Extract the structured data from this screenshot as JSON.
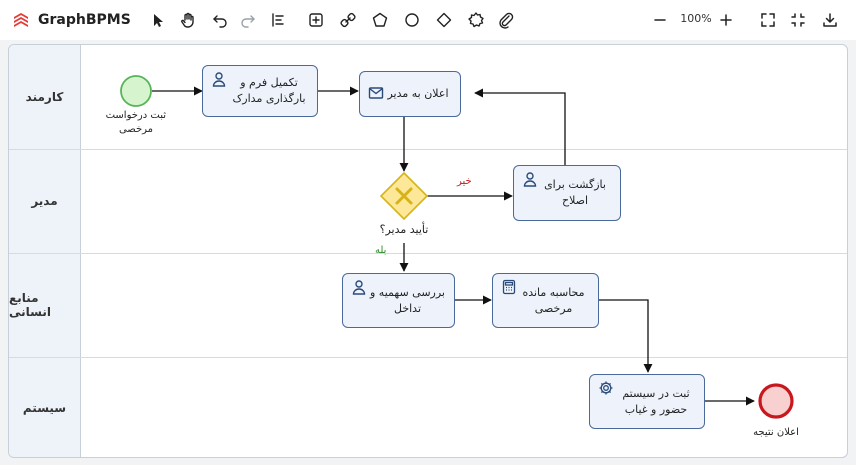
{
  "app": {
    "title": "GraphBPMS",
    "zoom": "100%"
  },
  "toolbar_tools": [
    "select-tool",
    "hand-tool",
    "undo",
    "redo",
    "align-tool",
    "insert-task-tool",
    "connector-tool",
    "pentagon-shape-tool",
    "circle-shape-tool",
    "diamond-shape-tool",
    "settings-shape-tool",
    "attachment-tool"
  ],
  "colors": {
    "brand": "#e53935",
    "task_fill": "#eef3fb",
    "task_stroke": "#4a6a9c",
    "start_fill": "#d6f5cf",
    "start_stroke": "#58b456",
    "end_fill": "#f8d0d0",
    "end_stroke": "#c8181e",
    "gateway_fill": "#fde89a",
    "gateway_stroke": "#d7b318",
    "no_label": "#c8181e",
    "yes_label": "#2e8b2e"
  },
  "lanes": [
    {
      "name": "کارمند"
    },
    {
      "name": "مدیر"
    },
    {
      "name": "منابع انسانی"
    },
    {
      "name": "سیستم"
    }
  ],
  "diagram": {
    "start_event": {
      "label": "ثبت درخواست مرخصی",
      "line1": "ثبت درخواست",
      "line2": "مرخصی"
    },
    "end_event": {
      "label": "اعلان نتیجه"
    },
    "gateway": {
      "label": "تأیید مدیر؟"
    },
    "tasks": {
      "fill_form": {
        "line1": "تکمیل فرم و",
        "line2": "بارگذاری مدارک",
        "icon": "user-icon"
      },
      "notify_manager": {
        "line1": "اعلان به مدیر",
        "icon": "envelope-icon"
      },
      "return_fix": {
        "line1": "بازگشت برای",
        "line2": "اصلاح",
        "icon": "user-icon"
      },
      "check_quota": {
        "line1": "بررسی سهمیه و",
        "line2": "تداخل",
        "icon": "user-icon"
      },
      "calc_balance": {
        "line1": "محاسبه مانده",
        "line2": "مرخصی",
        "icon": "calculator-icon"
      },
      "record_system": {
        "line1": "ثبت در سیستم",
        "line2": "حضور و غیاب",
        "icon": "gear-icon"
      }
    },
    "flows": {
      "no_label": "خیر",
      "yes_label": "بله"
    }
  }
}
